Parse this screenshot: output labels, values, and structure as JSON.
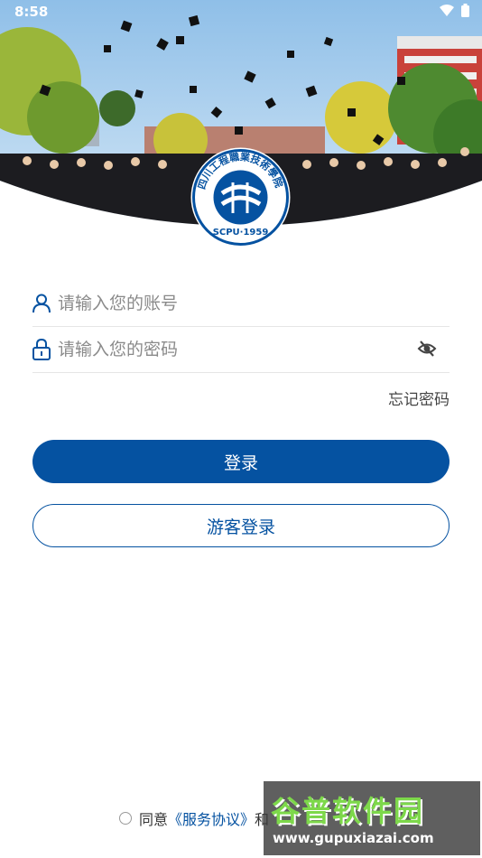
{
  "status_bar": {
    "time": "8:58"
  },
  "logo": {
    "arc_text": "四川工程職業技術學院",
    "caption": "SCPU·1959"
  },
  "form": {
    "account_placeholder": "请输入您的账号",
    "password_placeholder": "请输入您的密码",
    "forgot_password": "忘记密码"
  },
  "buttons": {
    "login": "登录",
    "guest_login": "游客登录"
  },
  "agreement": {
    "prefix": "同意",
    "service_agreement": "《服务协议》",
    "connector": "和"
  },
  "watermark": {
    "brand": "谷普软件园",
    "url": "www.gupuxiazai.com"
  },
  "colors": {
    "primary": "#0552a1",
    "sky": "#bcd8f0"
  },
  "icons": [
    "user-icon",
    "lock-icon",
    "eye-off-icon",
    "wifi-icon",
    "battery-icon"
  ]
}
